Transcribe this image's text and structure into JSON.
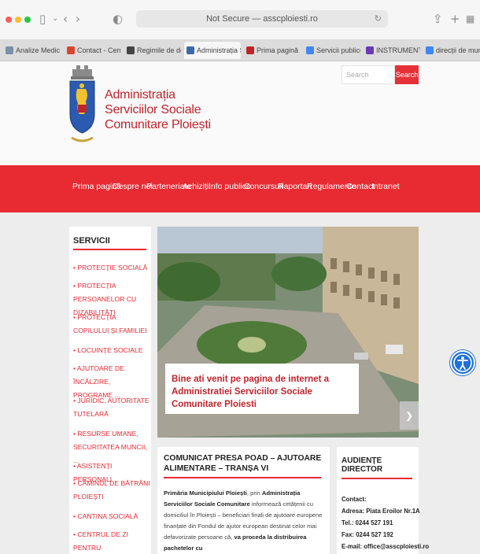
{
  "browser": {
    "url": "Not Secure — asscploiesti.ro",
    "tabs": [
      {
        "label": "Analize Medicale...",
        "color": "#7a8fa8"
      },
      {
        "label": "Contact - Centr...",
        "color": "#d9462f"
      },
      {
        "label": "Regimile de dez...",
        "color": "#444444"
      },
      {
        "label": "Administrația Ser...",
        "color": "#3a6aa8"
      },
      {
        "label": "Prima pagină",
        "color": "#c0242b"
      },
      {
        "label": "Servicii publice e...",
        "color": "#4285f4"
      },
      {
        "label": "INSTRUMENTE...",
        "color": "#6a3bb0"
      },
      {
        "label": "direcții de munc...",
        "color": "#4285f4"
      }
    ]
  },
  "header": {
    "brand_line1": "Administrația",
    "brand_line2": "Serviciilor Sociale",
    "brand_line3": "Comunitare Ploiești",
    "search_placeholder": "Search",
    "search_button": "Search"
  },
  "nav": {
    "items": [
      "Prima pagină",
      "Despre noi",
      "Parteneriate",
      "Achiziții",
      "Info publice",
      "Concursuri",
      "Raportari",
      "Regulamente",
      "Contact",
      "Intranet"
    ]
  },
  "sidebar": {
    "title": "SERVICII",
    "items": [
      "Protecție socială",
      "Protecția persoanelor cu dizabilități",
      "Protecția copilului și familiei",
      "Locuințe sociale",
      "Ajutoare de încălzire, programe ...",
      "Juridic, autoritate tutelară",
      "Resurse umane, securitatea muncii, ...",
      "Asistenți personali",
      "Căminul de bătrâni Ploiești",
      "Cantina socială",
      "Centrul de zi pentru"
    ]
  },
  "hero": {
    "caption": "Bine ati venit pe pagina de internet a Administratiei Serviciilor Sociale Comunitare Ploiesti"
  },
  "news": {
    "title": "COMUNICAT PRESA POAD – AJUTOARE ALIMENTARE – TRANȘA VI",
    "p_bold1": "Primăria Municipiului Ploiești",
    "p_text1": ", prin ",
    "p_bold2": "Administrația Serviciilor Sociale Comunitare",
    "p_text2": " informează cetățenii cu domiciliul în Ploiești – beneficiari finali de ajutoare europene finanțate din Fondul de ajutor european destinat celor mai defavorizate persoane că, ",
    "p_bold3": "va proceda la distribuirea pachetelor cu"
  },
  "director": {
    "title": "AUDIENȚE DIRECTOR",
    "contact_label": "Contact:",
    "address": "Adresa: Piata Eroilor Nr.1A",
    "phone": "Tel.: 0244 527 191",
    "fax": "Fax: 0244 527 192",
    "email": "E-mail: office@asscploiesti.ro"
  }
}
